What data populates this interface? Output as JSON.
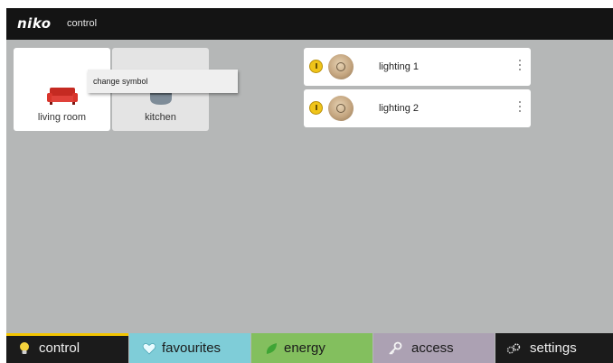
{
  "header": {
    "logo": "niko",
    "title": "control"
  },
  "rooms": [
    {
      "label": "living room",
      "icon": "sofa-icon",
      "selected": true
    },
    {
      "label": "kitchen",
      "icon": "kitchen-icon",
      "selected": false
    }
  ],
  "context_menu": {
    "items": [
      "change symbol"
    ]
  },
  "lights": [
    {
      "label": "lighting 1",
      "power_icon": "power-icon",
      "dimmer_icon": "dimmer-knob-icon"
    },
    {
      "label": "lighting 2",
      "power_icon": "power-icon",
      "dimmer_icon": "dimmer-knob-icon"
    }
  ],
  "bottom_nav": {
    "tabs": [
      {
        "label": "control",
        "icon": "bulb-icon",
        "color": "#1b1b1b",
        "accent": "#f2c400",
        "active": true
      },
      {
        "label": "favourites",
        "icon": "heart-icon",
        "color": "#7fcdd8"
      },
      {
        "label": "energy",
        "icon": "leaf-icon",
        "color": "#83bf5e"
      },
      {
        "label": "access",
        "icon": "key-icon",
        "color": "#aca1b3"
      },
      {
        "label": "settings",
        "icon": "gears-icon",
        "color": "#1b1b1b"
      }
    ]
  }
}
